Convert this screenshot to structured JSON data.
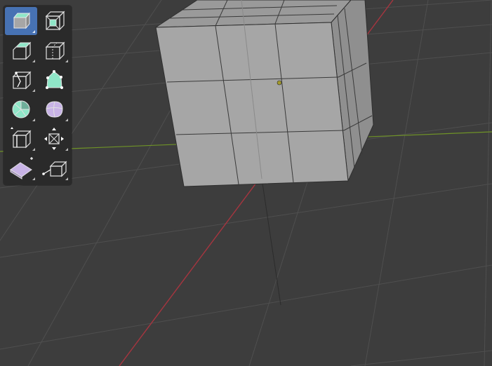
{
  "viewport": {
    "background": "#3d3d3d",
    "grid_color": "#4f4f4f",
    "x_axis_color": "#a6353f",
    "y_axis_color": "#6f9327",
    "object": {
      "name": "cube",
      "subdivisions": 3,
      "face_color": "#a6a6a6",
      "edge_color": "#2f2f2f"
    }
  },
  "toolbar": {
    "accent": "#4772b3",
    "tools": [
      {
        "icon": "extrude-region-icon",
        "active": true
      },
      {
        "icon": "inset-faces-icon",
        "active": false
      },
      {
        "icon": "bevel-icon",
        "active": false
      },
      {
        "icon": "loop-cut-icon",
        "active": false
      },
      {
        "icon": "knife-icon",
        "active": false
      },
      {
        "icon": "poly-build-icon",
        "active": false
      },
      {
        "icon": "spin-icon",
        "active": false
      },
      {
        "icon": "smooth-icon",
        "active": false
      },
      {
        "icon": "edge-slide-icon",
        "active": false
      },
      {
        "icon": "shrink-fatten-icon",
        "active": false
      },
      {
        "icon": "shear-icon",
        "active": false
      },
      {
        "icon": "rip-region-icon",
        "active": false
      }
    ]
  }
}
